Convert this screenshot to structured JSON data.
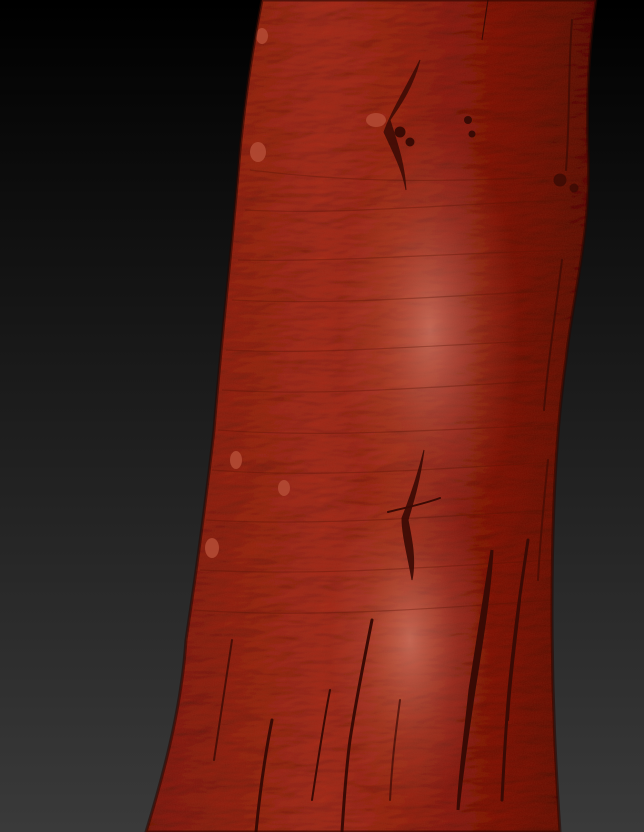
{
  "scene": {
    "subject": "tree-trunk-sculpt",
    "material": "clay",
    "colors": {
      "background_top": "#000000",
      "background_bottom": "#3a3a3a",
      "clay_base": "#8e2614",
      "clay_light": "#c85a45",
      "clay_highlight": "#e08570",
      "clay_shadow": "#4a0f06",
      "crevice": "#3a0a04"
    }
  }
}
